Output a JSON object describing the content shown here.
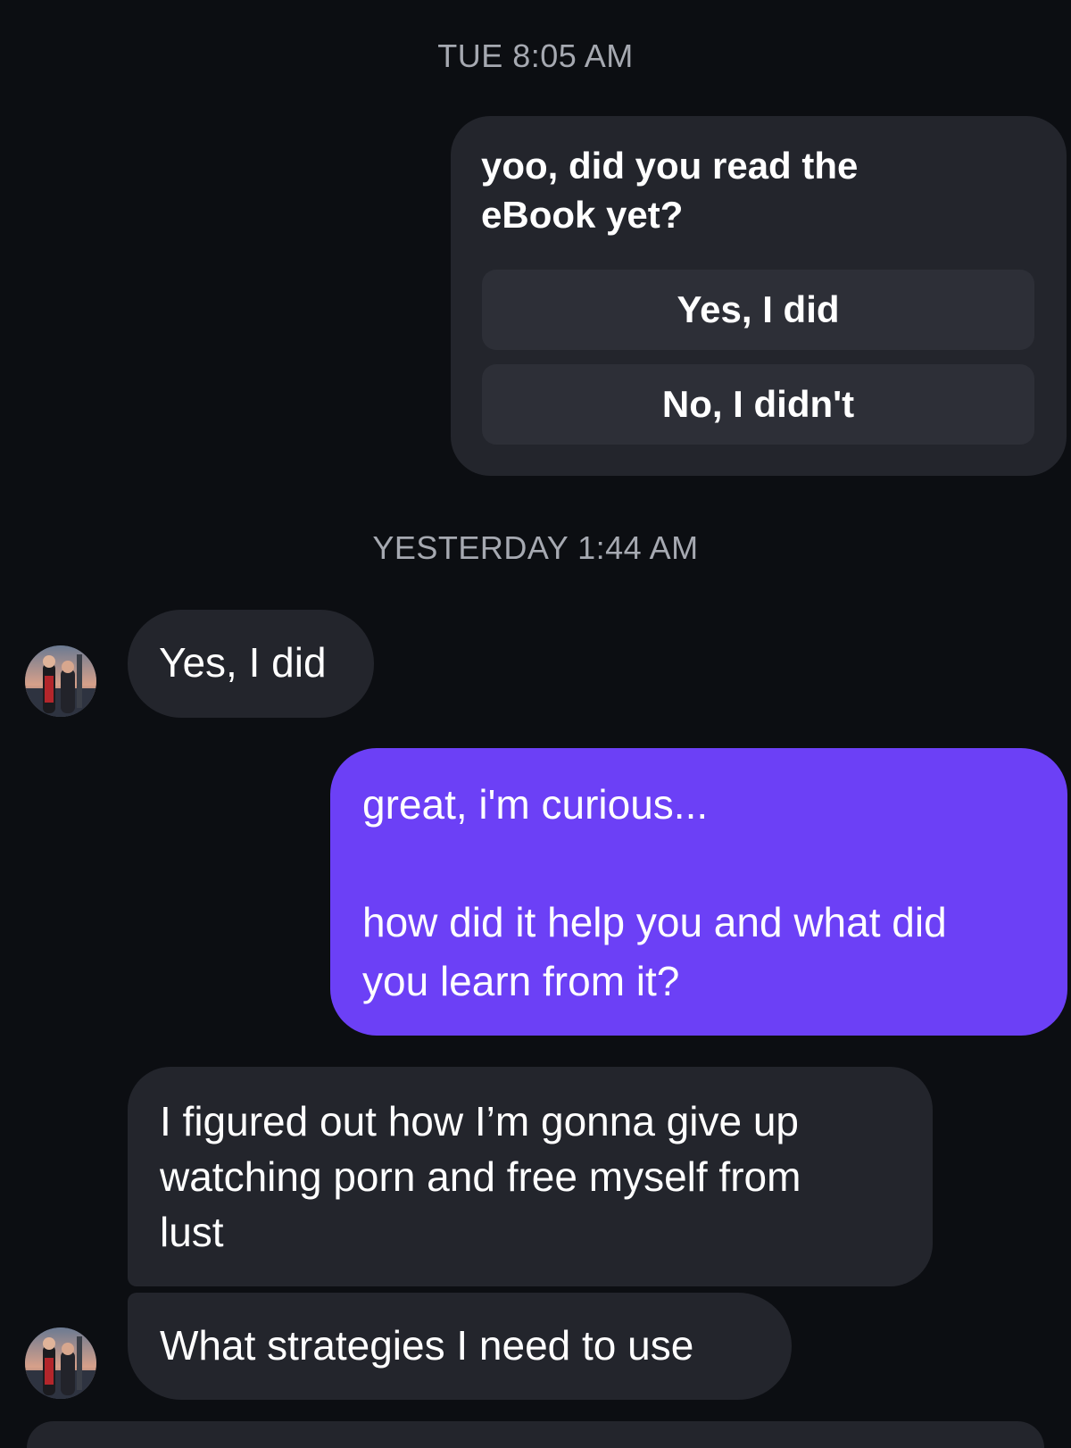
{
  "thread": {
    "timestamp_1": "TUE 8:05 AM",
    "timestamp_2": "YESTERDAY 1:44 AM"
  },
  "card": {
    "prompt_line_1": "yoo, did you read the",
    "prompt_line_2": "eBook yet?",
    "quick_replies": [
      {
        "label": "Yes, I did"
      },
      {
        "label": "No, I didn't"
      }
    ]
  },
  "messages": {
    "incoming_1": "Yes, I did",
    "outgoing_1_line_1": "great, i'm curious...",
    "outgoing_1_line_2": "how did it help you and what did",
    "outgoing_1_line_3": "you learn from it?",
    "incoming_2_line_1": "I figured out how I’m gonna give up",
    "incoming_2_line_2": "watching porn and free myself from",
    "incoming_2_line_3": "lust",
    "incoming_3": "What strategies I need to use"
  },
  "colors": {
    "background": "#0c0e12",
    "incoming_bubble": "#23252c",
    "outgoing_bubble": "#6c40f6",
    "timestamp_text": "#a6a9b1"
  },
  "icons": {
    "avatar": "contact-avatar-photo"
  }
}
